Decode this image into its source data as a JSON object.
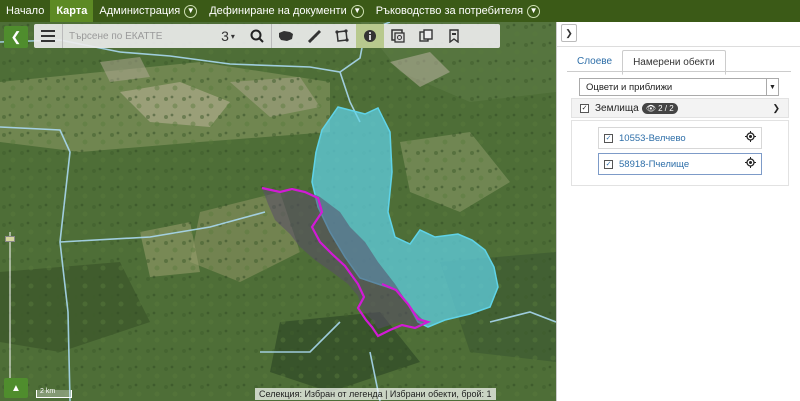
{
  "nav": {
    "home": "Начало",
    "map": "Карта",
    "admin": "Администрация",
    "docs": "Дефиниране на документи",
    "guide": "Ръководство за потребителя"
  },
  "toolbar": {
    "search_placeholder": "Търсене по ЕКАТТЕ",
    "select_value": "3"
  },
  "map": {
    "scale_label": "2 km",
    "status": "Селекция: Избран от легенда | Избрани обекти, брой: 1"
  },
  "panel": {
    "tabs": [
      "Слоеве",
      "Намерени обекти"
    ],
    "active_tab": 1,
    "color_select": "Оцвети и приближи",
    "group_label": "Землища",
    "group_badge": "2 / 2",
    "items": [
      {
        "label": "10553-Велчево",
        "checked": true,
        "selected": false
      },
      {
        "label": "58918-Пчелище",
        "checked": true,
        "selected": true
      }
    ]
  },
  "colors": {
    "nav_bg": "#3b5a17",
    "nav_active": "#5d8a24",
    "highlight_cyan": "#5fd3e8",
    "highlight_magenta": "#d21ad6",
    "boundary": "#a9d8f0"
  }
}
